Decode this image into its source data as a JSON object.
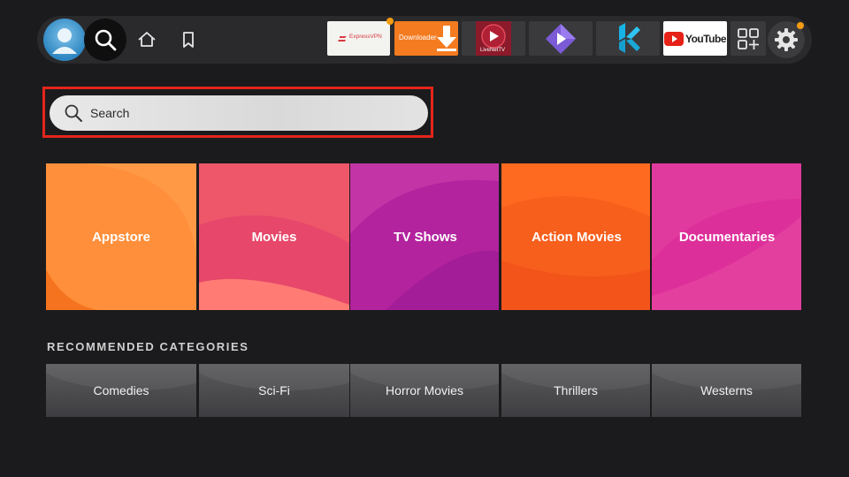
{
  "nav": {
    "apps": [
      {
        "name": "ExpressVPN",
        "label": "ExpressVPN",
        "bg": "#f3f3ef",
        "notify": true
      },
      {
        "name": "Downloader",
        "label": "Downloader",
        "bg": "#f47b20",
        "notify": false
      },
      {
        "name": "LiveNetTV",
        "label": "LiveNetTV",
        "bg": "#3a3a3d",
        "notify": false
      },
      {
        "name": "Stremio",
        "label": "",
        "bg": "#3a3a3d",
        "notify": false
      },
      {
        "name": "Kodi",
        "label": "",
        "bg": "#3a3a3d",
        "notify": false
      },
      {
        "name": "YouTube",
        "label": "YouTube",
        "bg": "#ffffff",
        "notify": false
      }
    ],
    "settings_notify": true
  },
  "search": {
    "placeholder": "Search"
  },
  "categories": [
    {
      "label": "Appstore",
      "c1": "#ff8a34",
      "c2": "#f76b1c"
    },
    {
      "label": "Movies",
      "c1": "#f0566b",
      "c2": "#e2496a"
    },
    {
      "label": "TV Shows",
      "c1": "#c2279f",
      "c2": "#a81c9a"
    },
    {
      "label": "Action Movies",
      "c1": "#ff6a1a",
      "c2": "#f04e16"
    },
    {
      "label": "Documentaries",
      "c1": "#e5369a",
      "c2": "#d62a9b"
    }
  ],
  "recommended": {
    "title": "RECOMMENDED CATEGORIES",
    "items": [
      "Comedies",
      "Sci-Fi",
      "Horror Movies",
      "Thrillers",
      "Westerns"
    ]
  },
  "colors": {
    "focus_outline": "#e5251b",
    "accent_notification": "#f39c12"
  }
}
